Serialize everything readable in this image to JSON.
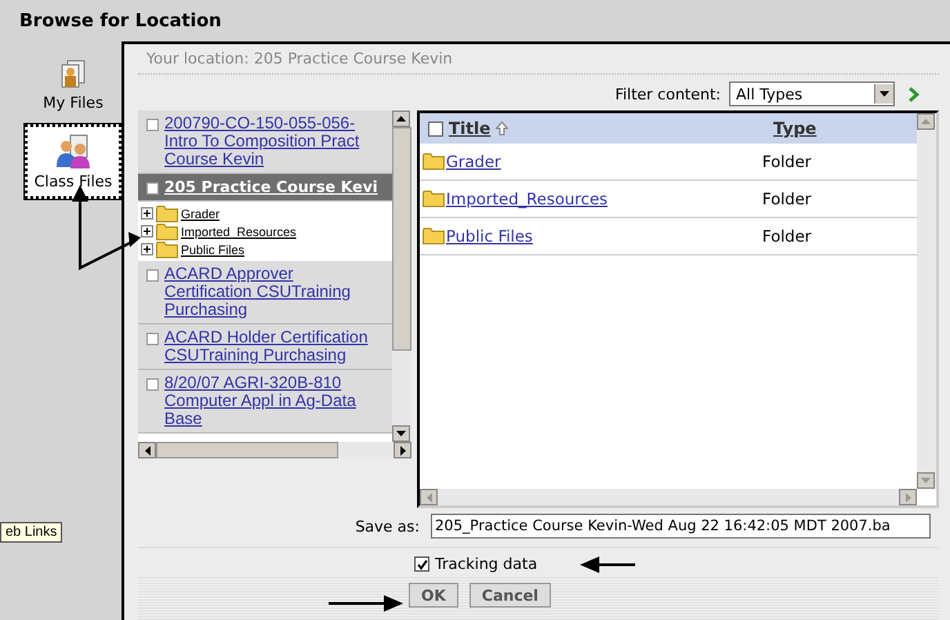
{
  "window": {
    "title": "Browse for Location"
  },
  "nav": [
    {
      "label": "My Files",
      "selected": false
    },
    {
      "label": "Class Files",
      "selected": true
    }
  ],
  "tooltip": "eb Links",
  "location": "Your location: 205 Practice Course Kevin",
  "filter": {
    "label": "Filter content:",
    "value": "All Types"
  },
  "tree": [
    {
      "lines": [
        "200790-CO-150-055-056-",
        "Intro To Composition Pract",
        "Course Kevin"
      ],
      "selected": false
    },
    {
      "lines": [
        "205 Practice Course Kevi"
      ],
      "selected": true,
      "children": [
        {
          "label": "Grader"
        },
        {
          "label": "Imported_Resources"
        },
        {
          "label": "Public Files"
        }
      ]
    },
    {
      "lines": [
        "ACARD Approver",
        "Certification CSUTraining",
        "Purchasing"
      ],
      "selected": false
    },
    {
      "lines": [
        "ACARD Holder Certification",
        "CSUTraining Purchasing"
      ],
      "selected": false
    },
    {
      "lines": [
        "8/20/07 AGRI-320B-810",
        "Computer Appl in Ag-Data",
        "Base"
      ],
      "selected": false
    }
  ],
  "table": {
    "columns": [
      "Title",
      "Type"
    ],
    "select_all_checked": false,
    "rows": [
      {
        "title": "Grader",
        "type": "Folder"
      },
      {
        "title": "Imported_Resources",
        "type": "Folder"
      },
      {
        "title": "Public Files",
        "type": "Folder"
      }
    ]
  },
  "save_as": {
    "label": "Save as:",
    "value": "205_Practice Course Kevin-Wed Aug 22 16:42:05 MDT 2007.ba"
  },
  "tracking": {
    "label": "Tracking data",
    "checked": true
  },
  "buttons": [
    "OK",
    "Cancel"
  ]
}
